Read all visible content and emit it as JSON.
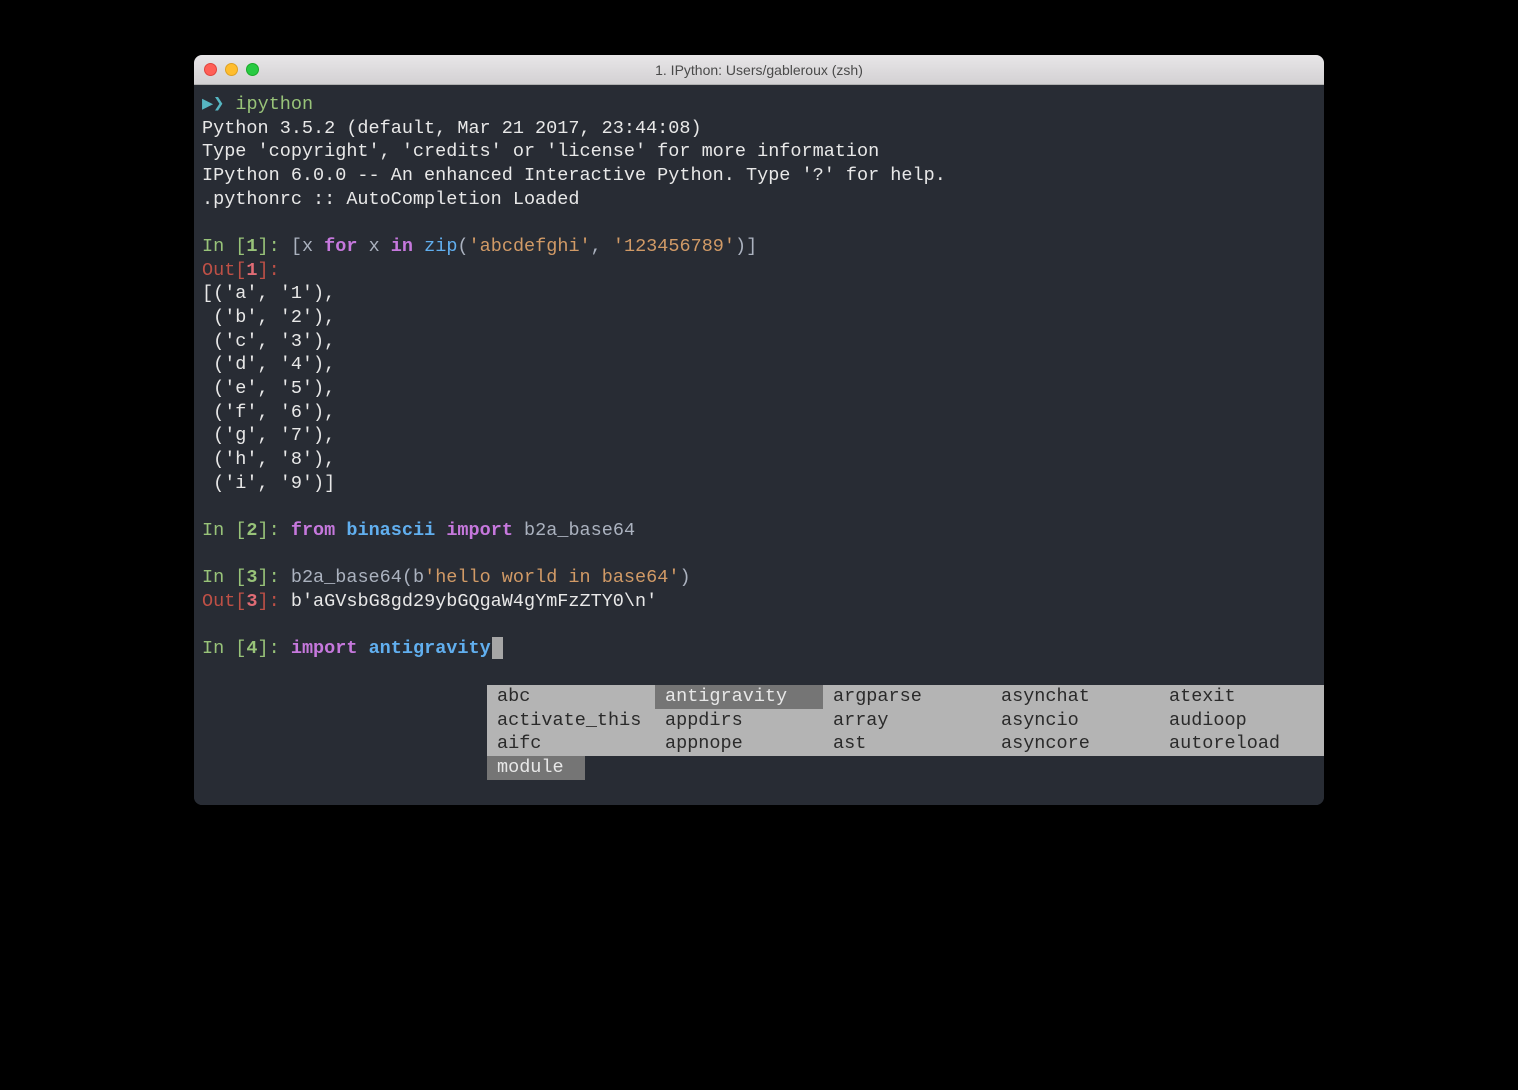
{
  "window": {
    "title": "1. IPython: Users/gableroux (zsh)"
  },
  "shell": {
    "chevrons": "▶❯ ",
    "command": "ipython"
  },
  "banner": {
    "line1": "Python 3.5.2 (default, Mar 21 2017, 23:44:08)",
    "line2": "Type 'copyright', 'credits' or 'license' for more information",
    "line3": "IPython 6.0.0 -- An enhanced Interactive Python. Type '?' for help.",
    "line4": ".pythonrc :: AutoCompletion Loaded"
  },
  "cells": {
    "c1": {
      "in_prefix": "In [",
      "in_num": "1",
      "in_suffix": "]: ",
      "open": "[x ",
      "kw_for": "for",
      "mid1": " x ",
      "kw_in": "in",
      "mid2": " ",
      "fn": "zip",
      "paren_open": "(",
      "str1": "'abcdefghi'",
      "comma": ", ",
      "str2": "'123456789'",
      "close": ")]",
      "out_prefix": "Out[",
      "out_num": "1",
      "out_suffix": "]:",
      "out_lines": [
        "[('a', '1'),",
        " ('b', '2'),",
        " ('c', '3'),",
        " ('d', '4'),",
        " ('e', '5'),",
        " ('f', '6'),",
        " ('g', '7'),",
        " ('h', '8'),",
        " ('i', '9')]"
      ]
    },
    "c2": {
      "in_prefix": "In [",
      "in_num": "2",
      "in_suffix": "]: ",
      "kw_from": "from",
      "sp1": " ",
      "mod": "binascii",
      "sp2": " ",
      "kw_import": "import",
      "sp3": " ",
      "name": "b2a_base64"
    },
    "c3": {
      "in_prefix": "In [",
      "in_num": "3",
      "in_suffix": "]: ",
      "fn": "b2a_base64",
      "open": "(",
      "bprefix": "b",
      "str": "'hello world in base64'",
      "close": ")",
      "out_prefix": "Out[",
      "out_num": "3",
      "out_suffix": "]: ",
      "out_bprefix": "b",
      "out_str": "'aGVsbG8gd29ybGQgaW4gYmFzZTY0\\n'"
    },
    "c4": {
      "in_prefix": "In [",
      "in_num": "4",
      "in_suffix": "]: ",
      "kw_import": "import",
      "sp": " ",
      "mod": "antigravity"
    }
  },
  "completion": {
    "rows": [
      [
        "abc",
        "antigravity",
        "argparse",
        "asynchat",
        "atexit"
      ],
      [
        "activate_this",
        "appdirs",
        "array",
        "asyncio",
        "audioop"
      ],
      [
        "aifc",
        "appnope",
        "ast",
        "asyncore",
        "autoreload"
      ]
    ],
    "selected": {
      "row": 0,
      "col": 1
    },
    "type_label": "module "
  }
}
